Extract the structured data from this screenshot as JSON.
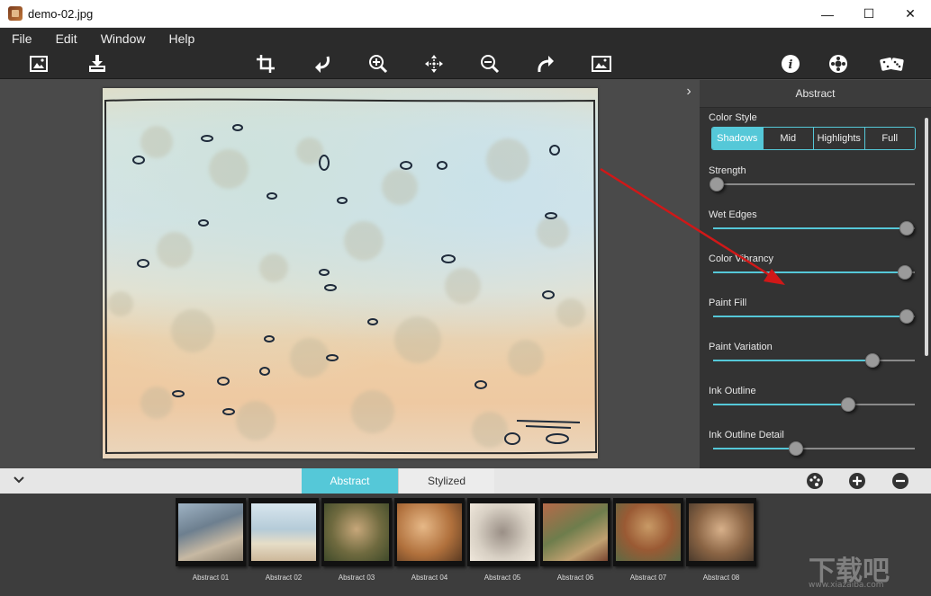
{
  "window": {
    "title": "demo-02.jpg",
    "controls": {
      "minimize": "—",
      "maximize": "☐",
      "close": "✕"
    }
  },
  "menu": [
    "File",
    "Edit",
    "Window",
    "Help"
  ],
  "toolbar": {
    "left": [
      "open-image-icon",
      "save-image-icon"
    ],
    "center": [
      "crop-icon",
      "undo-icon",
      "zoom-in-icon",
      "pan-icon",
      "zoom-out-icon",
      "redo-icon",
      "fit-image-icon"
    ],
    "right": [
      "info-icon",
      "settings-icon",
      "random-dice-icon"
    ]
  },
  "panel": {
    "title": "Abstract",
    "color_style": {
      "label": "Color Style",
      "options": [
        "Shadows",
        "Mid",
        "Highlights",
        "Full"
      ],
      "selected": "Shadows"
    },
    "sliders": [
      {
        "label": "Strength",
        "value": 0.02
      },
      {
        "label": "Wet Edges",
        "value": 0.96
      },
      {
        "label": "Color Vibrancy",
        "value": 0.95
      },
      {
        "label": "Paint Fill",
        "value": 0.96
      },
      {
        "label": "Paint Variation",
        "value": 0.79
      },
      {
        "label": "Ink Outline",
        "value": 0.67
      },
      {
        "label": "Ink Outline Detail",
        "value": 0.41
      }
    ]
  },
  "bottom": {
    "tabs": [
      "Abstract",
      "Stylized"
    ],
    "active_tab": "Abstract",
    "actions": [
      "palette-icon",
      "add-icon",
      "remove-icon"
    ]
  },
  "presets": [
    "Abstract 01",
    "Abstract 02",
    "Abstract 03",
    "Abstract 04",
    "Abstract 05",
    "Abstract 06",
    "Abstract 07",
    "Abstract 08"
  ],
  "watermark": {
    "text": "下载吧",
    "sub": "www.xiazaiba.com"
  },
  "colors": {
    "accent": "#55c8d8",
    "arrow": "#d01818"
  }
}
